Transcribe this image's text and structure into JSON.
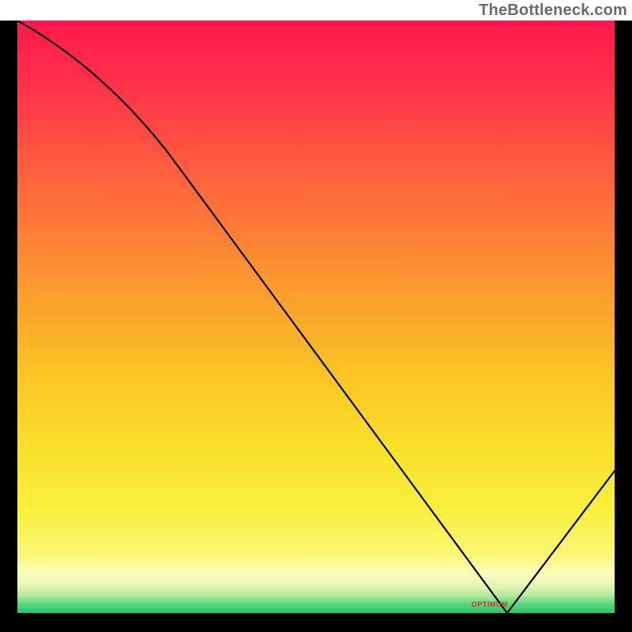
{
  "attribution": "TheBottleneck.com",
  "chart_data": {
    "type": "line",
    "title": "",
    "xlabel": "",
    "ylabel": "",
    "x_range": [
      0,
      100
    ],
    "y_range": [
      0,
      100
    ],
    "curve_points": [
      {
        "x": 0,
        "y": 100
      },
      {
        "x": 25,
        "y": 78
      },
      {
        "x": 82,
        "y": 0
      },
      {
        "x": 100,
        "y": 24
      }
    ],
    "optimum_x": 82,
    "marker_label": "OPTIMUM",
    "background_gradient": {
      "stops": [
        {
          "offset": 0.0,
          "color": "#ff1a4b"
        },
        {
          "offset": 0.1,
          "color": "#ff2f49"
        },
        {
          "offset": 0.22,
          "color": "#fe5540"
        },
        {
          "offset": 0.35,
          "color": "#fd7c36"
        },
        {
          "offset": 0.48,
          "color": "#fba32b"
        },
        {
          "offset": 0.6,
          "color": "#fac524"
        },
        {
          "offset": 0.72,
          "color": "#f9e02a"
        },
        {
          "offset": 0.82,
          "color": "#f9ef3b"
        },
        {
          "offset": 0.9,
          "color": "#f9f773"
        },
        {
          "offset": 0.935,
          "color": "#fbfcbf"
        },
        {
          "offset": 0.955,
          "color": "#e1f6b2"
        },
        {
          "offset": 0.97,
          "color": "#b3ec9e"
        },
        {
          "offset": 0.985,
          "color": "#59d77f"
        },
        {
          "offset": 1.0,
          "color": "#1ec96a"
        }
      ]
    }
  }
}
